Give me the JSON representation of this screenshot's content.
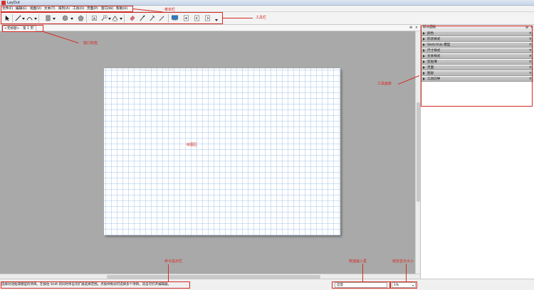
{
  "window": {
    "title": "LayOut"
  },
  "menu": [
    "文件(F)",
    "编辑(E)",
    "视图(V)",
    "文本(T)",
    "排列(A)",
    "工具(O)",
    "页面(P)",
    "窗口(W)",
    "帮助(H)"
  ],
  "tab": {
    "label": "<无标题> - 第 1 页"
  },
  "tray": {
    "title": "默认面板",
    "panels": [
      "颜色",
      "形状样式",
      "SketchUp 模型",
      "尺寸样式",
      "文本样式",
      "剪贴簿",
      "页面",
      "图层",
      "工具向导"
    ]
  },
  "status": {
    "hint": "选择对话框或模型的项目。在按住 Shift 的同时单击可扩展选择范围。点按并拖动可选择多个项目。双击可打开编辑器。",
    "measurements_label": "度量",
    "zoom": "1%"
  },
  "annotations": {
    "menubar": "菜单栏",
    "toolbar": "工具栏",
    "tab": "窗口标签",
    "tray": "工具面板",
    "drawing": "绘图区",
    "statusbar": "命令提示栏",
    "input": "数值输入框",
    "zoom": "纸张显示大小"
  },
  "colors": {
    "annotation": "#d42a22",
    "canvas": "#a9a9a9",
    "grid": "#aac8eb"
  }
}
